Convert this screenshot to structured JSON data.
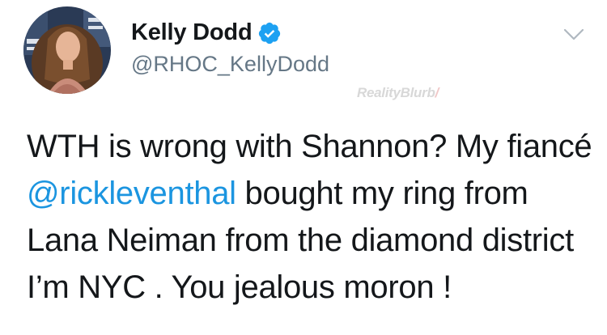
{
  "author": {
    "display_name": "Kelly Dodd",
    "handle": "@RHOC_KellyDodd",
    "verified": true
  },
  "watermark": {
    "text": "RealityBlurb",
    "mark": "/"
  },
  "tweet": {
    "segments": [
      {
        "type": "text",
        "value": "WTH is wrong with Shannon?  My fiancé "
      },
      {
        "type": "mention",
        "value": "@rickleventhal"
      },
      {
        "type": "text",
        "value": " bought my ring from Lana Neiman from the diamond district I’m NYC . You jealous moron !"
      }
    ]
  },
  "icons": {
    "verified": "verified-badge-icon",
    "menu": "chevron-down-icon"
  },
  "colors": {
    "mention": "#1b95e0",
    "verified": "#1da1f2",
    "secondary_text": "#657786",
    "primary_text": "#14171a"
  }
}
